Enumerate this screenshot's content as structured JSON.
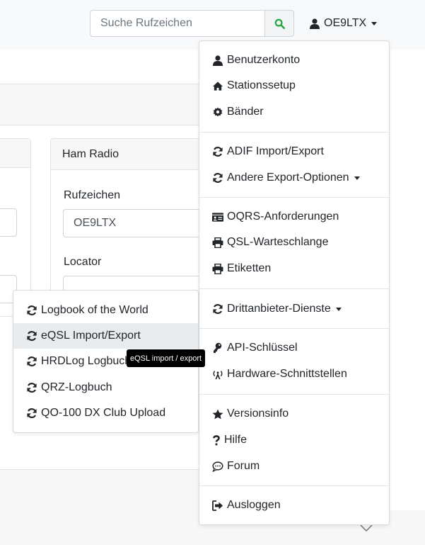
{
  "search": {
    "placeholder": "Suche Rufzeichen"
  },
  "user": {
    "callsign": "OE9LTX"
  },
  "dropdown": {
    "items": [
      {
        "label": "Benutzerkonto",
        "icon": "user-icon"
      },
      {
        "label": "Stationssetup",
        "icon": "home-icon"
      },
      {
        "label": "Bänder",
        "icon": "gear-icon"
      },
      {
        "label": "ADIF Import/Export",
        "icon": "sync-icon"
      },
      {
        "label": "Andere Export-Optionen",
        "icon": "sync-icon"
      },
      {
        "label": "OQRS-Anforderungen",
        "icon": "id-card-icon"
      },
      {
        "label": "QSL-Warteschlange",
        "icon": "print-icon"
      },
      {
        "label": "Etiketten",
        "icon": "print-icon"
      },
      {
        "label": "Drittanbieter-Dienste",
        "icon": "sync-icon"
      },
      {
        "label": "API-Schlüssel",
        "icon": "key-icon"
      },
      {
        "label": "Hardware-Schnittstellen",
        "icon": "antenna-icon"
      },
      {
        "label": "Versionsinfo",
        "icon": "star-icon"
      },
      {
        "label": "Hilfe",
        "icon": "question-icon"
      },
      {
        "label": "Forum",
        "icon": "comment-icon"
      },
      {
        "label": "Ausloggen",
        "icon": "sign-out-icon"
      }
    ]
  },
  "submenu": {
    "items": [
      {
        "label": "Logbook of the World"
      },
      {
        "label": "eQSL Import/Export"
      },
      {
        "label": "HRDLog Logbuch"
      },
      {
        "label": "QRZ-Logbuch"
      },
      {
        "label": "QO-100 DX Club Upload"
      }
    ],
    "tooltip": "eQSL import / export"
  },
  "card": {
    "title": "Ham Radio",
    "callsign_label": "Rufzeichen",
    "callsign_value": "OE9LTX",
    "locator_label": "Locator",
    "locator_value": ""
  },
  "colors": {
    "success": "#28a745",
    "text": "#212529",
    "hover": "#e9ecef"
  }
}
